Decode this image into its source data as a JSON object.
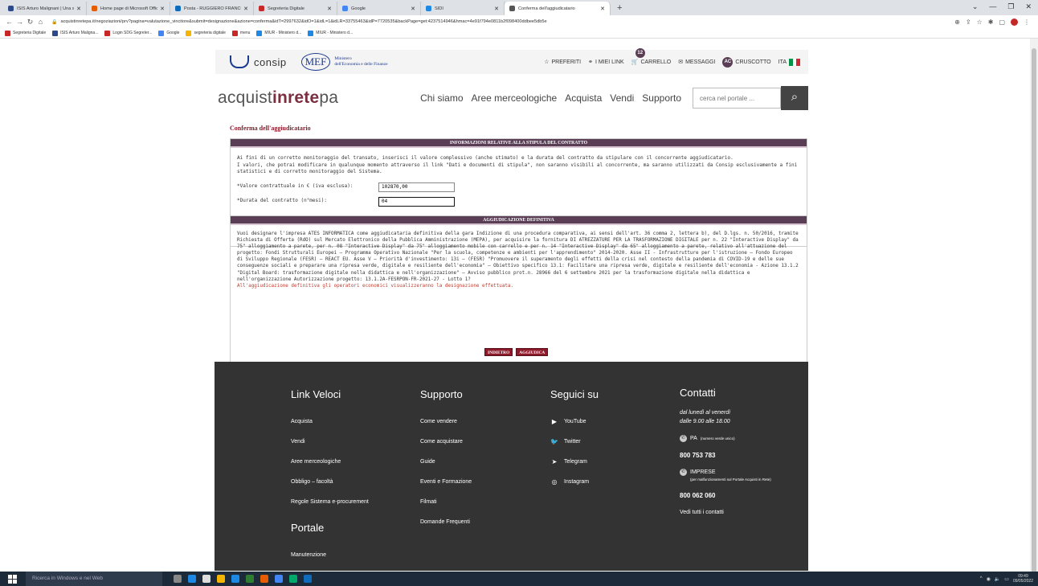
{
  "browser": {
    "tabs": [
      {
        "label": "ISIS Arturo Malignani | Una scuo",
        "icon_color": "#2b4a8a"
      },
      {
        "label": "Home page di Microsoft Office",
        "icon_color": "#e65c00"
      },
      {
        "label": "Posta - RUGGIERO FRANCO - O",
        "icon_color": "#0f6cbd"
      },
      {
        "label": "Segreteria Digitale",
        "icon_color": "#c62828"
      },
      {
        "label": "Google",
        "icon_color": "#4285f4"
      },
      {
        "label": "SIDI",
        "icon_color": "#1e88e5"
      },
      {
        "label": "Conferma dell'aggiudicatario",
        "icon_color": "#555555",
        "active": true
      }
    ],
    "url": "acquistinretepa.it/negoziazioni/prv?pagina=valutazione_vincitore&submit=designazione&azione=conferma&idT=2997632&idO=1&idL=1&idLR=33755463&idP=7720535&backPage=get:4237514946&hmac=4e91f794e0811b2f098400ddbee5db5e",
    "bookmarks": [
      {
        "label": "Segreteria Digitale",
        "icon_color": "#c62828"
      },
      {
        "label": "ISIS Arturo Maligna...",
        "icon_color": "#2b4a8a"
      },
      {
        "label": "Login SDG Segreter...",
        "icon_color": "#c62828"
      },
      {
        "label": "Google",
        "icon_color": "#4285f4"
      },
      {
        "label": "segreteria digitale",
        "icon_color": "#f4b400"
      },
      {
        "label": "menu",
        "icon_color": "#c62828"
      },
      {
        "label": "MIUR - Ministero d...",
        "icon_color": "#1e88e5"
      },
      {
        "label": "MIUR - Ministero d...",
        "icon_color": "#1e88e5"
      }
    ]
  },
  "header": {
    "consip": "consip",
    "mef_logo": "MEF",
    "mef_line1": "Ministero",
    "mef_line2": "dell'Economia e delle Finanze",
    "preferiti": "PREFERITI",
    "miei_link": "I MIEI LINK",
    "carrello": "CARRELLO",
    "cart_count": "12",
    "messaggi": "MESSAGGI",
    "avatar": "AC",
    "cruscotto": "CRUSCOTTO",
    "lang": "ITA"
  },
  "nav": {
    "brand_a": "acquist",
    "brand_b": "inrete",
    "brand_c": "pa",
    "items": [
      "Chi siamo",
      "Aree merceologiche",
      "Acquista",
      "Vendi",
      "Supporto"
    ],
    "search_placeholder": "cerca nel portale ..."
  },
  "page_title": "Conferma dell'aggiudicatario",
  "section1": {
    "header": "INFORMAZIONI RELATIVE ALLA STIPULA DEL CONTRATTO",
    "intro1": "Ai fini di un corretto monitoraggio del transato, inserisci il valore complessivo (anche stimato) e la durata del contratto da stipulare con il concorrente aggiudicatario.",
    "intro2": "I valori, che potrai modificare in qualunque momento attraverso il link \"Dati e documenti di stipula\", non saranno visibili al concorrente, ma saranno utilizzati da Consip esclusivamente a fini statistici e di corretto monitoraggio del Sistema.",
    "valore_label": "*Valore contrattuale in € (iva esclusa):",
    "valore_value": "102870,00",
    "durata_label": "*Durata del contratto (n°mesi):",
    "durata_value": "04"
  },
  "section2": {
    "header": "AGGIUDICAZIONE DEFINITIVA",
    "body": "Vuoi designare l'impresa ATES INFORMATICA come aggiudicataria definitiva della gara Indizione di una procedura comparativa, ai sensi dell'art. 36 comma 2, lettera b), del D.lgs. n. 50/2016, tramite Richiesta di Offerta (RdO) sul Mercato Elettronico della Pubblica Amministrazione (MEPA), per acquisire la fornitura DI ATREZZATURE PER LA TRASFORMAZIONE DIGITALE per n. 22 \"Interactive Display\" da 75\" alloggiamento a parete, per n. 08 \"Interactive Display\" da 75\" alloggiamento mobile con carrello e per n. 14 \"Interactive Display\" da 65\" alloggiamento a parete, relativo all'attuazione del progetto: Fondi Strutturali Europei – Programma Operativo Nazionale \"Per la scuola, competenze e ambienti per l'apprendimento\" 2014-2020. Asse II - Infrastrutture per l'istruzione – Fondo Europeo di Sviluppo Regionale (FESR) – REACT EU. Asse V – Priorità d'investimento: 13i – (FESR) \"Promuovere il superamento degli effetti della crisi nel contesto della pandemia di COVID-19 e delle sue conseguenze sociali e preparare una ripresa verde, digitale e resiliente dell'economia\" – Obiettivo specifico 13.1: Facilitare una ripresa verde, digitale e resiliente dell'economia - Azione 13.1.2 \"Digital Board: trasformazione digitale nella didattica e nell'organizzazione\" – Avviso pubblico prot.n. 28966 del 6 settembre 2021 per la trasformazione digitale nella didattica e nell'organizzazione Autorizzazione progetto: 13.1.2A-FESRPON-FR-2021-27 - Lotto 1?",
    "warning": "All'aggiudicazione definitiva gli operatori economici visualizzeranno la designazione effettuata."
  },
  "buttons": {
    "indietro": "INDIETRO",
    "aggiudica": "AGGIUDICA"
  },
  "footer": {
    "link_veloci": {
      "title": "Link Veloci",
      "items": [
        "Acquista",
        "Vendi",
        "Aree merceologiche",
        "Obbligo – facoltà",
        "Regole Sistema e-procurement"
      ]
    },
    "portale": {
      "title": "Portale",
      "items": [
        "Manutenzione"
      ]
    },
    "supporto": {
      "title": "Supporto",
      "items": [
        "Come vendere",
        "Come acquistare",
        "Guide",
        "Eventi e Formazione",
        "Filmati",
        "Domande Frequenti"
      ]
    },
    "seguici": {
      "title": "Seguici su",
      "items": [
        "YouTube",
        "Twitter",
        "Telegram",
        "Instagram"
      ]
    },
    "contatti": {
      "title": "Contatti",
      "hours1": "dal lunedì al venerdì",
      "hours2": "dalle 9.00 alle 18.00",
      "pa_label": "PA",
      "pa_sub": "(numero verde unico)",
      "pa_number": "800 753 783",
      "imprese_label": "IMPRESE",
      "imprese_sub": "(per malfunzionamenti sul Portale Acquisti in Rete)",
      "imprese_number": "800 062 060",
      "all_contacts": "Vedi tutti i contatti"
    }
  },
  "taskbar": {
    "search": "Ricerca in Windows e nel Web",
    "time": "09:49",
    "date": "09/05/2022",
    "icon_colors": [
      "#888888",
      "#1e88e5",
      "#dddddd",
      "#f4b400",
      "#1e88e5",
      "#2e7d32",
      "#e65c00",
      "#4285f4",
      "#00a86b",
      "#0f6cbd"
    ]
  }
}
